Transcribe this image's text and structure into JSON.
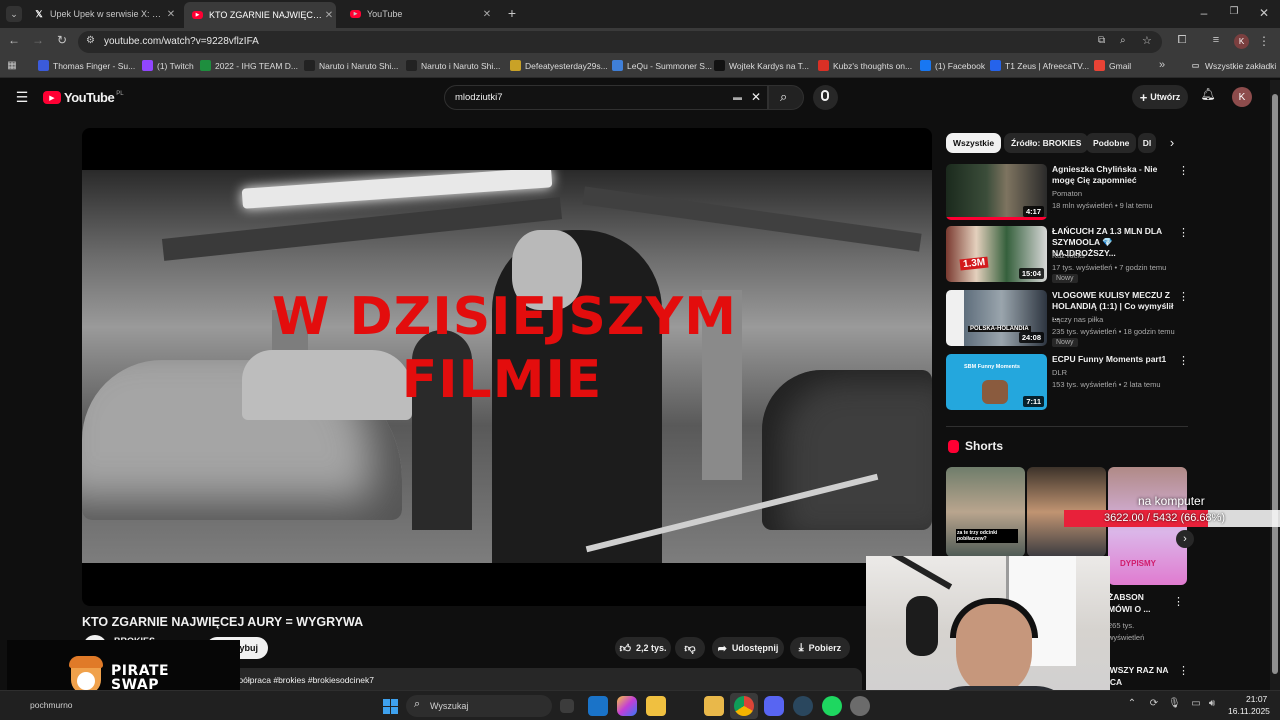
{
  "browser": {
    "tabs": [
      {
        "label": "Upek Upek w serwisie X: „@yvn",
        "icon": "x-logo-icon",
        "active": false
      },
      {
        "label": "KTO ZGARNIE NAJWIĘCEJ AURY",
        "icon": "youtube-icon",
        "active": true
      },
      {
        "label": "YouTube",
        "icon": "youtube-icon",
        "active": false
      }
    ],
    "url": "youtube.com/watch?v=9228vflzIFA",
    "bookmarks": [
      {
        "label": "Thomas Finger - Su...",
        "color": "#3b5bdb"
      },
      {
        "label": "(1) Twitch",
        "color": "#9146ff"
      },
      {
        "label": "2022 - IHG TEAM D...",
        "color": "#1e8e3e"
      },
      {
        "label": "Naruto i Naruto Shi...",
        "color": "#222222"
      },
      {
        "label": "Naruto i Naruto Shi...",
        "color": "#222222"
      },
      {
        "label": "Defeatyesterday29s...",
        "color": "#c9a227"
      },
      {
        "label": "LeQu - Summoner S...",
        "color": "#3f7fd8"
      },
      {
        "label": "Wojtek Kardys na T...",
        "color": "#111111"
      },
      {
        "label": "Kubz's thoughts on...",
        "color": "#d93025"
      },
      {
        "label": "(1) Facebook",
        "color": "#1877f2"
      },
      {
        "label": "T1 Zeus | AfreecaTV...",
        "color": "#2563eb"
      },
      {
        "label": "Gmail",
        "color": "#ea4335"
      }
    ],
    "all_bookmarks": "Wszystkie zakładki",
    "profile_initial": "K"
  },
  "youtube": {
    "logo": "YouTube",
    "region": "PL",
    "search_value": "mlodziutki7",
    "create_label": "Utwórz",
    "avatar_initial": "K",
    "video": {
      "overlay_line1": "W DZISIEJSZYM",
      "overlay_line2": "FILMIE",
      "title": "KTO ZGARNIE NAJWIĘCEJ AURY = WYGRYWA",
      "channel": "BROKIES",
      "subscribe": "Subskrybuj",
      "likes": "2,2 tys.",
      "share": "Udostępnij",
      "download": "Pobierz",
      "description": "współpraca #brokies #brokiesodcinek7"
    },
    "chips": [
      "Wszystkie",
      "Źródło: BROKIES",
      "Podobne",
      "Dl"
    ],
    "recommendations": [
      {
        "title": "Agnieszka Chylińska - Nie mogę Cię zapomnieć",
        "channel": "Pomaton",
        "meta": "18 mln wyświetleń • 9 lat temu",
        "duration": "4:17",
        "badge": ""
      },
      {
        "title": "ŁAŃCUCH ZA 1.3 MLN DLA SZYMOOLA 💎 NAJDROŻSZY...",
        "channel": "Kuz Kicks",
        "meta": "17 tys. wyświetleń • 7 godzin temu",
        "duration": "15:04",
        "badge": "Nowy",
        "thumb_text": "1.3M"
      },
      {
        "title": "VLOGOWE KULISY MECZU Z HOLANDIĄ (1:1) | Co wymyślił ...",
        "channel": "Łączy nas piłka",
        "meta": "235 tys. wyświetleń • 18 godzin temu",
        "duration": "24:08",
        "badge": "Nowy",
        "thumb_text": "POLSKA-HOLANDIA"
      },
      {
        "title": "ECPU Funny Moments part1",
        "channel": "DLR",
        "meta": "153 tys. wyświetleń • 2 lata temu",
        "duration": "7:11",
        "badge": "",
        "thumb_text": "SBM Funny Moments"
      }
    ],
    "shorts_heading": "Shorts",
    "shorts": [
      {
        "caption": "za te trzy odcinki pobiłaczew?"
      },
      {
        "caption": ""
      },
      {
        "caption": "DYPISMY"
      }
    ],
    "short_side": {
      "title": "ŻABSON MÓWI O ...",
      "views": "265 tys. wyświetleń"
    },
    "short_side2": {
      "title": "PIERWSZY RAZ NA ANTICA"
    }
  },
  "overlay": {
    "goal_label": "na komputer",
    "goal_progress": "3622.00 / 5432 (66.68%)",
    "goal_fraction": 0.6668,
    "sponsor_line1": "PIRATE",
    "sponsor_line2": "SWAP"
  },
  "taskbar": {
    "search_placeholder": "Wyszukaj",
    "time": "21:07",
    "date": "16.11.2025",
    "weather": "pochmurno"
  }
}
